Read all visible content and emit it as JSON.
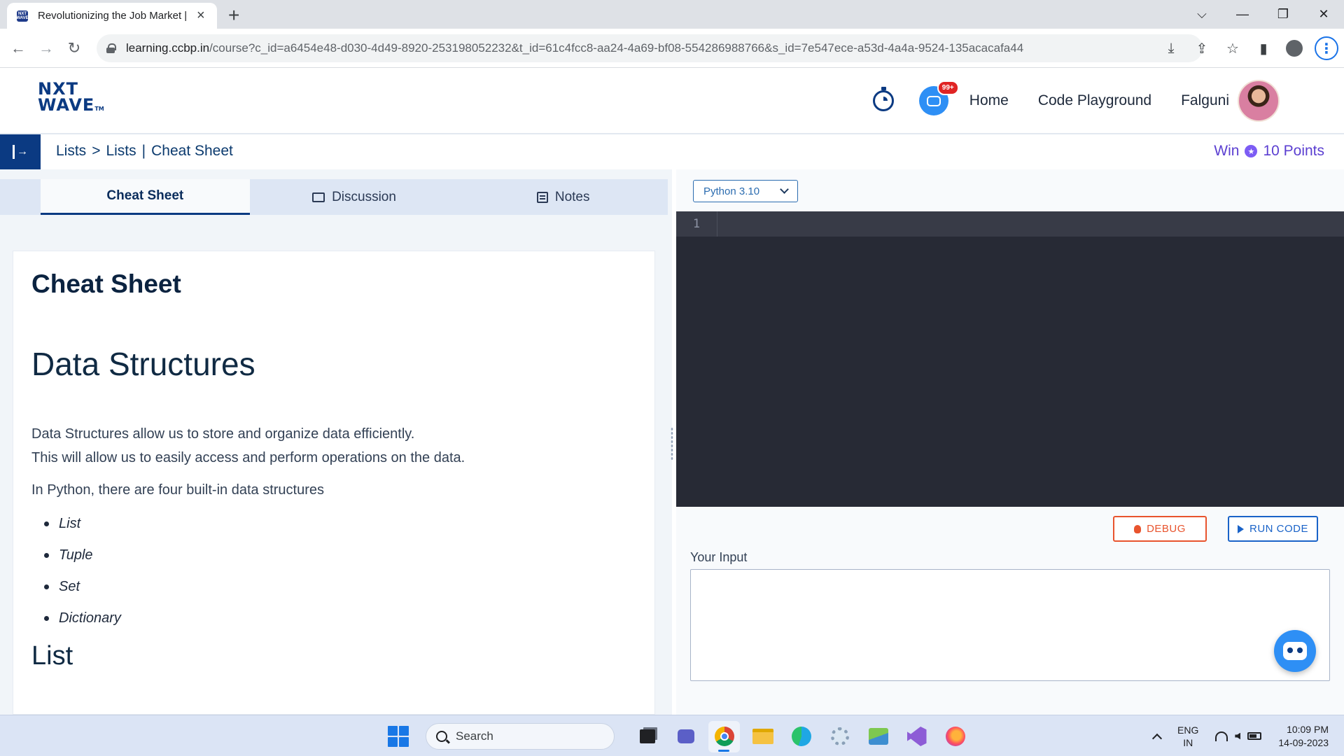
{
  "browser": {
    "tab_title": "Revolutionizing the Job Market |",
    "favicon_text": "NXT WAVE",
    "url_host": "learning.ccbp.in",
    "url_path": "/course?c_id=a6454e48-d030-4d49-8920-253198052232&t_id=61c4fcc8-aa24-4a69-bf08-554286988766&s_id=7e547ece-a53d-4a4a-9524-135acacafa44"
  },
  "header": {
    "logo_line1": "NXT",
    "logo_line2": "WAVE",
    "logo_tm": "TM",
    "notification_badge": "99+",
    "nav": {
      "home": "Home",
      "code_playground": "Code Playground"
    },
    "user_name": "Falguni"
  },
  "subheader": {
    "breadcrumb": [
      "Lists",
      ">",
      "Lists",
      "|",
      "Cheat Sheet"
    ],
    "win_label": "Win",
    "points_label": "10 Points"
  },
  "left_panel": {
    "tabs": [
      {
        "label": "Cheat Sheet",
        "active": true
      },
      {
        "label": "Discussion",
        "active": false
      },
      {
        "label": "Notes",
        "active": false
      }
    ],
    "content": {
      "title": "Cheat Sheet",
      "section_heading": "Data Structures",
      "paragraph_line1": "Data Structures allow us to store and organize data efficiently.",
      "paragraph_line2": "This will allow us to easily access and perform operations on the data.",
      "paragraph2": "In Python, there are four built-in data structures",
      "bullets": [
        "List",
        "Tuple",
        "Set",
        "Dictionary"
      ],
      "next_heading": "List"
    }
  },
  "right_panel": {
    "language": "Python 3.10",
    "editor_line_number": "1",
    "debug_label": "DEBUG",
    "run_label": "RUN CODE",
    "input_label": "Your Input",
    "input_value": ""
  },
  "taskbar": {
    "search_placeholder": "Search",
    "lang_line1": "ENG",
    "lang_line2": "IN",
    "time": "10:09 PM",
    "date": "14-09-2023"
  },
  "colors": {
    "brand_navy": "#0b3a82",
    "editor_bg": "#272a35",
    "debug_orange": "#e8542e",
    "run_blue": "#1a63c8",
    "points_purple": "#5b3fd1"
  }
}
